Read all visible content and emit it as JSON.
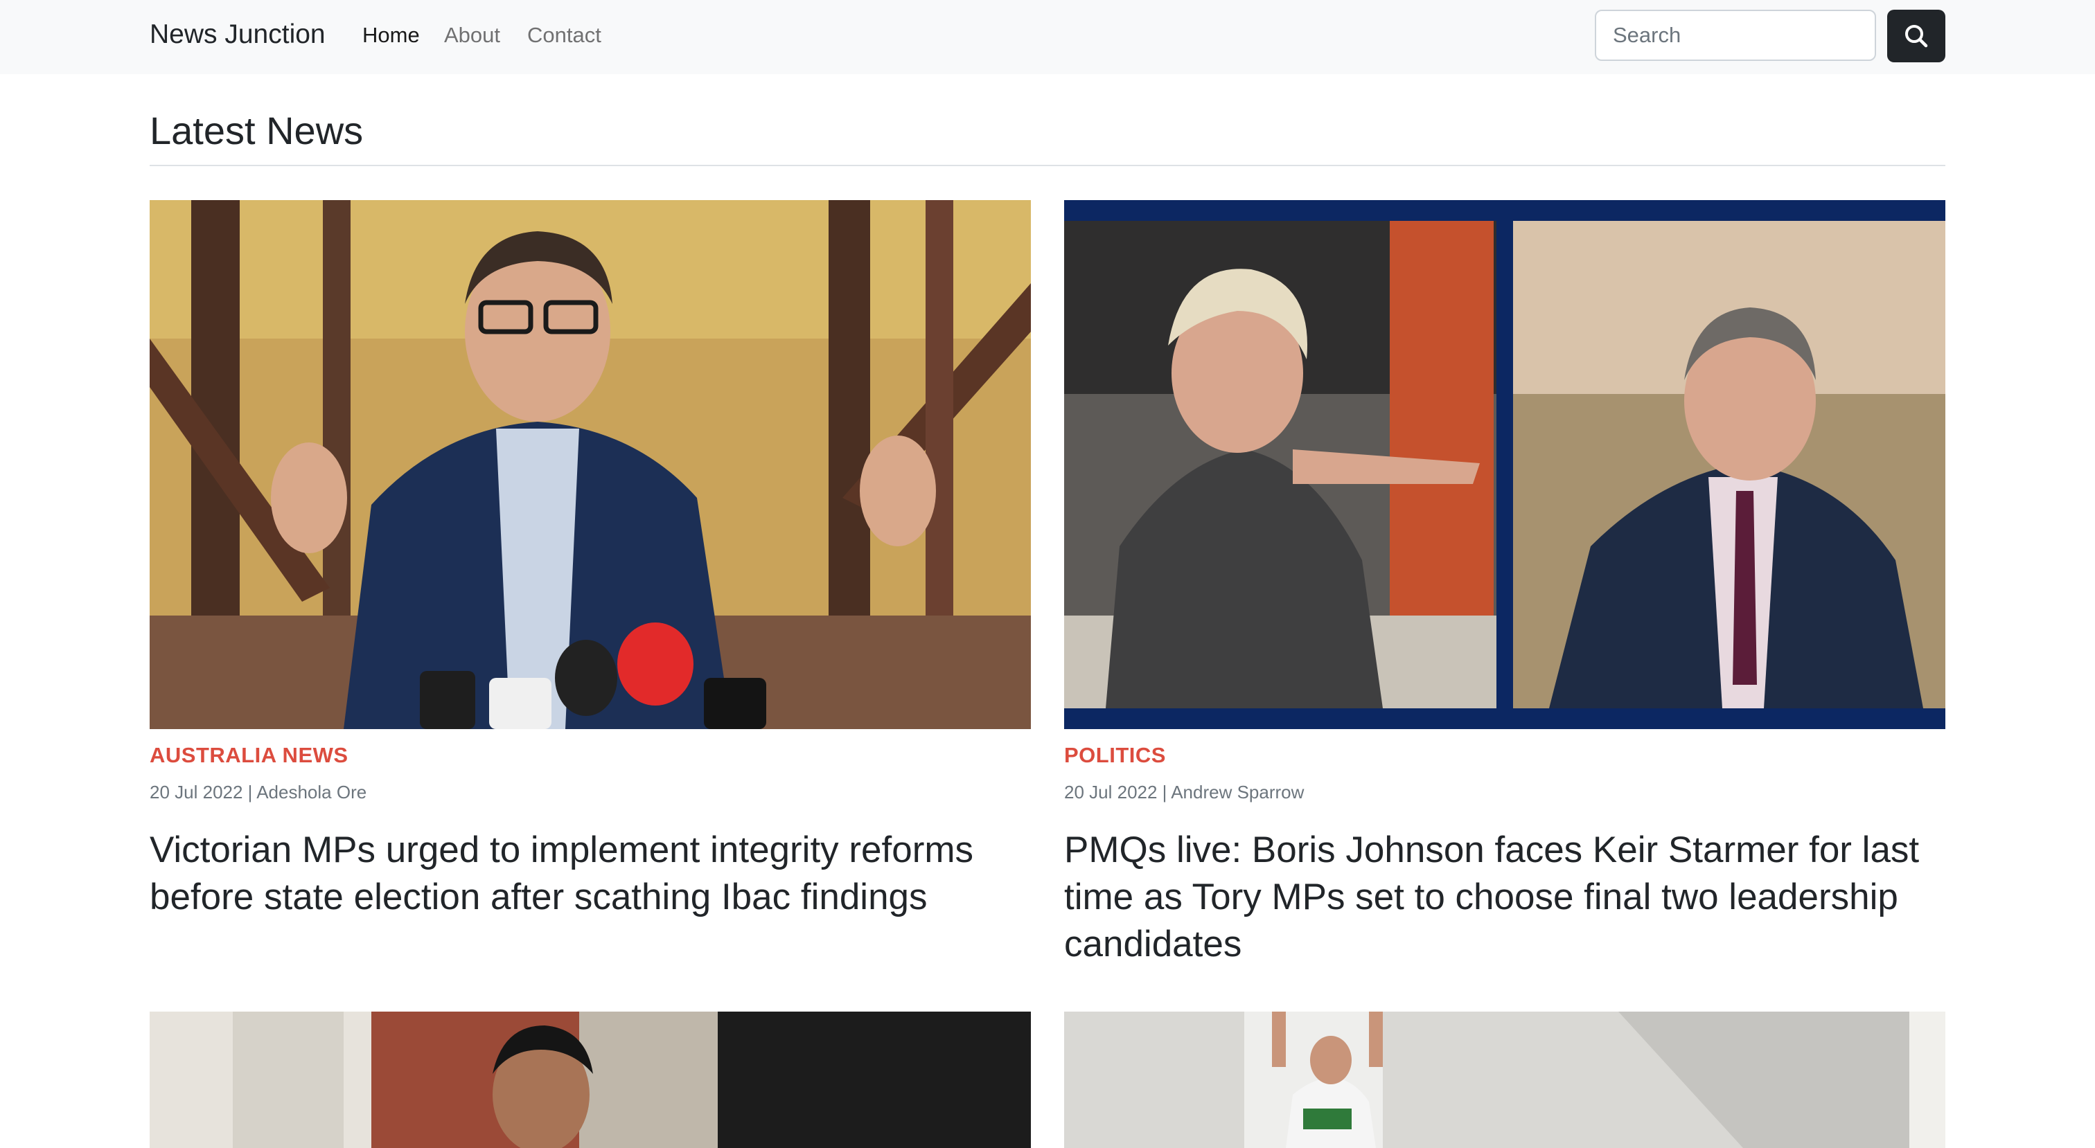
{
  "navbar": {
    "brand": "News Junction",
    "links": [
      {
        "label": "Home",
        "active": true
      },
      {
        "label": "About",
        "active": false
      },
      {
        "label": "Contact",
        "active": false
      }
    ],
    "search": {
      "placeholder": "Search",
      "value": ""
    },
    "search_icon": "search-icon"
  },
  "main": {
    "section_title": "Latest News",
    "articles": [
      {
        "category": "AUSTRALIA NEWS",
        "date": "20 Jul 2022",
        "author": "Adeshola Ore",
        "meta": "20 Jul 2022 | Adeshola Ore",
        "title": "Victorian MPs urged to implement integrity reforms before state election after scathing Ibac findings"
      },
      {
        "category": "POLITICS",
        "date": "20 Jul 2022",
        "author": "Andrew Sparrow",
        "meta": "20 Jul 2022 | Andrew Sparrow",
        "title": "PMQs live: Boris Johnson faces Keir Starmer for last time as Tory MPs set to choose final two leadership candidates"
      }
    ]
  },
  "colors": {
    "category": "#dc4c3e",
    "navbar_bg": "#f8f9fa",
    "button_dark": "#212529"
  }
}
